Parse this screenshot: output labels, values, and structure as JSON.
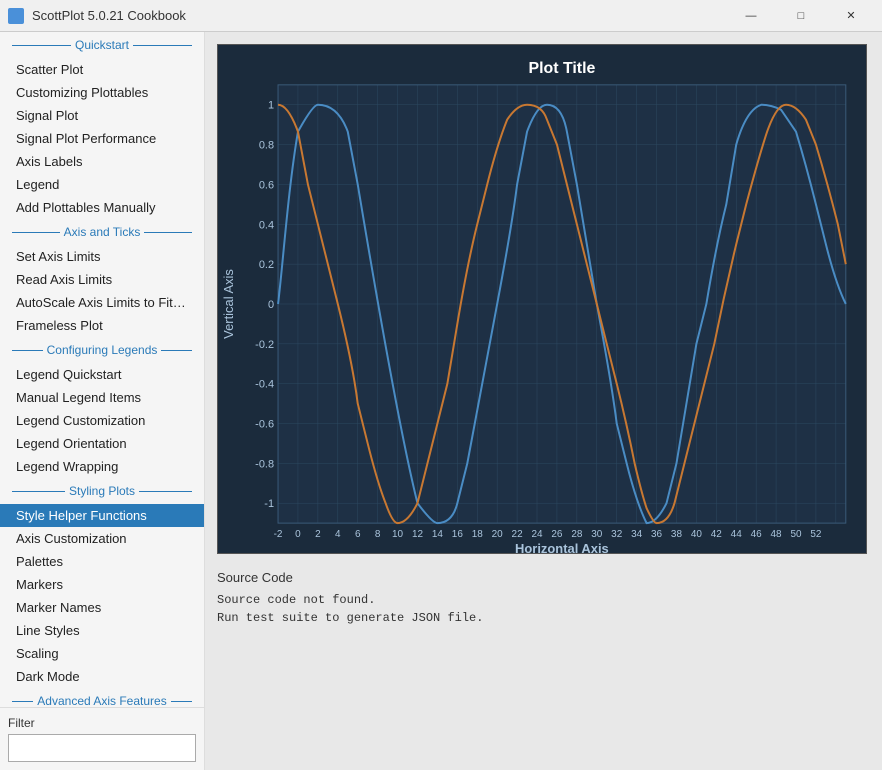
{
  "titlebar": {
    "title": "ScottPlot 5.0.21 Cookbook",
    "minimize": "—",
    "maximize": "□",
    "close": "✕"
  },
  "sidebar": {
    "sections": [
      {
        "type": "header",
        "label": "Quickstart"
      },
      {
        "type": "item",
        "label": "Scatter Plot",
        "active": false
      },
      {
        "type": "item",
        "label": "Customizing Plottables",
        "active": false
      },
      {
        "type": "item",
        "label": "Signal Plot",
        "active": false
      },
      {
        "type": "item",
        "label": "Signal Plot Performance",
        "active": false
      },
      {
        "type": "item",
        "label": "Axis Labels",
        "active": false
      },
      {
        "type": "item",
        "label": "Legend",
        "active": false
      },
      {
        "type": "item",
        "label": "Add Plottables Manually",
        "active": false
      },
      {
        "type": "header",
        "label": "Axis and Ticks"
      },
      {
        "type": "item",
        "label": "Set Axis Limits",
        "active": false
      },
      {
        "type": "item",
        "label": "Read Axis Limits",
        "active": false
      },
      {
        "type": "item",
        "label": "AutoScale Axis Limits to Fit Da...",
        "active": false
      },
      {
        "type": "item",
        "label": "Frameless Plot",
        "active": false
      },
      {
        "type": "header",
        "label": "Configuring Legends"
      },
      {
        "type": "item",
        "label": "Legend Quickstart",
        "active": false
      },
      {
        "type": "item",
        "label": "Manual Legend Items",
        "active": false
      },
      {
        "type": "item",
        "label": "Legend Customization",
        "active": false
      },
      {
        "type": "item",
        "label": "Legend Orientation",
        "active": false
      },
      {
        "type": "item",
        "label": "Legend Wrapping",
        "active": false
      },
      {
        "type": "header",
        "label": "Styling Plots"
      },
      {
        "type": "item",
        "label": "Style Helper Functions",
        "active": true
      },
      {
        "type": "item",
        "label": "Axis Customization",
        "active": false
      },
      {
        "type": "item",
        "label": "Palettes",
        "active": false
      },
      {
        "type": "item",
        "label": "Markers",
        "active": false
      },
      {
        "type": "item",
        "label": "Marker Names",
        "active": false
      },
      {
        "type": "item",
        "label": "Line Styles",
        "active": false
      },
      {
        "type": "item",
        "label": "Scaling",
        "active": false
      },
      {
        "type": "item",
        "label": "Dark Mode",
        "active": false
      },
      {
        "type": "header",
        "label": "Advanced Axis Features"
      }
    ],
    "filter_label": "Filter",
    "filter_placeholder": ""
  },
  "plot": {
    "title": "Plot Title",
    "x_label": "Horizontal Axis",
    "y_label": "Vertical Axis",
    "background": "#1a2a3a",
    "grid_color": "#2a3f55",
    "x_ticks": [
      "-2",
      "0",
      "2",
      "4",
      "6",
      "8",
      "10",
      "12",
      "14",
      "16",
      "18",
      "20",
      "22",
      "24",
      "26",
      "28",
      "30",
      "32",
      "34",
      "36",
      "38",
      "40",
      "42",
      "44",
      "46",
      "48",
      "50",
      "52"
    ],
    "y_ticks": [
      "-1",
      "-0.8",
      "-0.6",
      "-0.4",
      "-0.2",
      "0",
      "0.2",
      "0.4",
      "0.6",
      "0.8",
      "1"
    ]
  },
  "source": {
    "header": "Source Code",
    "line1": "Source code not found.",
    "line2": "Run test suite to generate JSON file."
  }
}
